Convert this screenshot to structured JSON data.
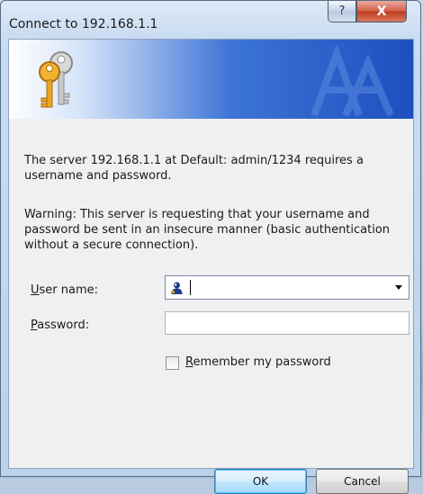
{
  "window": {
    "title": "Connect to 192.168.1.1",
    "help_label": "?",
    "close_label": "X"
  },
  "icons": {
    "banner": "keys-icon",
    "user": "user-icon",
    "dropdown": "chevron-down-icon"
  },
  "message": {
    "line1": "The server 192.168.1.1  at Default: admin/1234 requires a username and password.",
    "warning": "Warning: This server is requesting that your username and password be sent in an insecure manner (basic authentication without a secure connection)."
  },
  "form": {
    "username_label_accel": "U",
    "username_label_rest": "ser name:",
    "username_value": "",
    "password_label_accel": "P",
    "password_label_rest": "assword:",
    "password_value": "",
    "remember_accel": "R",
    "remember_rest": "emember my password",
    "remember_checked": false
  },
  "buttons": {
    "ok": "OK",
    "cancel": "Cancel"
  },
  "colors": {
    "banner_dark": "#1d4fbf",
    "close_red": "#c03b1f"
  }
}
